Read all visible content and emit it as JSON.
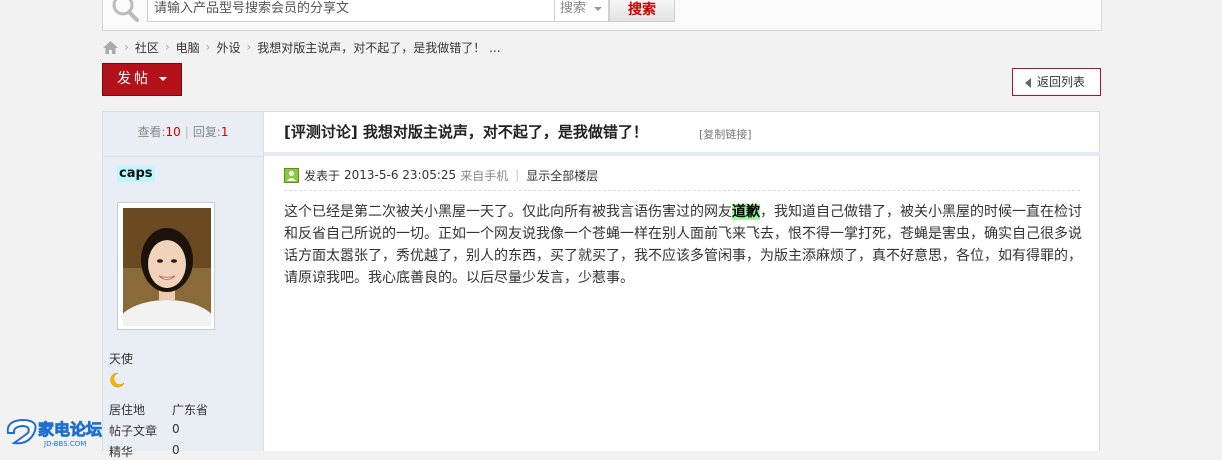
{
  "search": {
    "placeholder": "请输入产品型号搜索会员的分享文",
    "type_label": "搜索",
    "button_label": "搜索"
  },
  "breadcrumb": {
    "items": [
      "社区",
      "电脑",
      "外设",
      "我想对版主说声，对不起了，是我做错了！ ..."
    ]
  },
  "toolbar": {
    "post_label": "发帖",
    "back_label": "返回列表"
  },
  "thread": {
    "views_label": "查看:",
    "views": "10",
    "replies_label": "回复:",
    "replies": "1",
    "title": "[评测讨论] 我想对版主说声，对不起了，是我做错了！",
    "copy_link": "[复制链接]"
  },
  "author": {
    "name": "caps",
    "rank": "天使",
    "info": [
      {
        "label": "居住地",
        "value": "广东省"
      },
      {
        "label": "帖子文章",
        "value": "0"
      },
      {
        "label": "精华",
        "value": "0"
      }
    ]
  },
  "post": {
    "posted_prefix": "发表于",
    "timestamp": "2013-5-6 23:05:25",
    "source": "来自手机",
    "show_all": "显示全部楼层",
    "body_before": "这个已经是第二次被关小黑屋一天了。仅此向所有被我言语伤害过的网友",
    "body_highlight": "道歉",
    "body_after": "，我知道自己做错了，被关小黑屋的时候一直在检讨和反省自己所说的一切。正如一个网友说我像一个苍蝇一样在别人面前飞来飞去，恨不得一掌打死，苍蝇是害虫，确实自己很多说话方面太嚣张了，秀优越了，别人的东西，买了就买了，我不应该多管闲事，为版主添麻烦了，真不好意思，各位，如有得罪的，请原谅我吧。我心底善良的。以后尽量少发言，少惹事。"
  },
  "watermark": {
    "brand": "家电论坛",
    "domain": "JD-BBS.COM"
  },
  "colors": {
    "accent_red": "#b4121a",
    "highlight_green": "#9ff79f",
    "username_bg": "#bff6ff",
    "sidebar_bg": "#e9eef4"
  }
}
